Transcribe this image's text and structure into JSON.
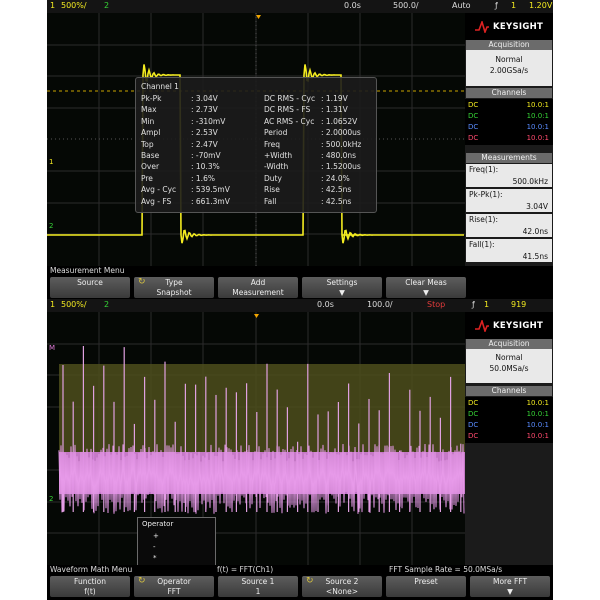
{
  "top": {
    "header": {
      "ch_num": "1",
      "ch_scale": "500%/",
      "ch2": "2",
      "time_pos": "0.0s",
      "time_scale": "500.0/",
      "trig_mode": "Auto",
      "trig_sym": "ƒ",
      "trig_ch": "1",
      "trig_level": "1.20V"
    },
    "brand": "KEYSIGHT",
    "acquisition": {
      "title": "Acquisition",
      "mode": "Normal",
      "rate": "2.00GSa/s"
    },
    "channels": {
      "title": "Channels",
      "rows": [
        {
          "coupling": "DC",
          "value": "10.0:1",
          "color": "#f2ea20"
        },
        {
          "coupling": "DC",
          "value": "10.0:1",
          "color": "#36d236"
        },
        {
          "coupling": "DC",
          "value": "10.0:1",
          "color": "#5a8cff"
        },
        {
          "coupling": "DC",
          "value": "10.0:1",
          "color": "#ff4a6e"
        }
      ]
    },
    "measurements": {
      "title": "Measurements",
      "items": [
        {
          "label": "Freq(1):",
          "value": "500.0kHz"
        },
        {
          "label": "Pk-Pk(1):",
          "value": "3.04V"
        },
        {
          "label": "Rise(1):",
          "value": "42.0ns"
        },
        {
          "label": "Fall(1):",
          "value": "41.5ns"
        }
      ]
    },
    "overlay": {
      "title": "Channel 1",
      "left": [
        [
          "Pk-Pk",
          ": 3.04V"
        ],
        [
          "Max",
          ": 2.73V"
        ],
        [
          "Min",
          ": -310mV"
        ],
        [
          "Ampl",
          ": 2.53V"
        ],
        [
          "Top",
          ": 2.47V"
        ],
        [
          "Base",
          ": -70mV"
        ],
        [
          "Over",
          ": 10.3%"
        ],
        [
          "Pre",
          ": 1.6%"
        ],
        [
          "Avg - Cyc",
          ": 539.5mV"
        ],
        [
          "Avg - FS",
          ": 661.3mV"
        ]
      ],
      "right": [
        [
          "DC RMS - Cyc",
          ": 1.19V"
        ],
        [
          "DC RMS - FS",
          ": 1.31V"
        ],
        [
          "AC RMS - Cyc",
          ": 1.0652V"
        ],
        [
          "Period",
          ": 2.0000us"
        ],
        [
          "Freq",
          ": 500.0kHz"
        ],
        [
          "+Width",
          ": 480.0ns"
        ],
        [
          "-Width",
          ": 1.5200us"
        ],
        [
          "Duty",
          ": 24.0%"
        ],
        [
          "Rise",
          ": 42.5ns"
        ],
        [
          "Fall",
          ": 42.5ns"
        ]
      ]
    },
    "menu_title": "Measurement Menu",
    "softkeys": [
      {
        "l1": "Source",
        "l2": ""
      },
      {
        "l1": "Type",
        "l2": "Snapshot",
        "icon": "↻"
      },
      {
        "l1": "Add",
        "l2": "Measurement"
      },
      {
        "l1": "Settings",
        "l2": "▼"
      },
      {
        "l1": "Clear Meas",
        "l2": "▼"
      }
    ]
  },
  "bottom": {
    "header": {
      "ch_num": "1",
      "ch_scale": "500%/",
      "ch2": "2",
      "time_pos": "0.0s",
      "time_scale": "100.0/",
      "trig_mode": "Stop",
      "trig_sym": "ƒ",
      "trig_ch": "1",
      "trig_level": "919"
    },
    "brand": "KEYSIGHT",
    "acquisition": {
      "title": "Acquisition",
      "mode": "Normal",
      "rate": "50.0MSa/s"
    },
    "channels": {
      "title": "Channels",
      "rows": [
        {
          "coupling": "DC",
          "value": "10.0:1",
          "color": "#f2ea20"
        },
        {
          "coupling": "DC",
          "value": "10.0:1",
          "color": "#36d236"
        },
        {
          "coupling": "DC",
          "value": "10.0:1",
          "color": "#5a8cff"
        },
        {
          "coupling": "DC",
          "value": "10.0:1",
          "color": "#ff4a6e"
        }
      ]
    },
    "operator_dropdown": {
      "title": "Operator",
      "items": [
        "+",
        "-",
        "*",
        "FFT"
      ],
      "selected": "FFT"
    },
    "menu_title": "Waveform Math Menu",
    "formula": "f(t) = FFT(Ch1)",
    "sample_rate": "FFT Sample Rate = 50.0MSa/s",
    "softkeys": [
      {
        "l1": "Function",
        "l2": "f(t)"
      },
      {
        "l1": "Operator",
        "l2": "FFT",
        "icon": "↻"
      },
      {
        "l1": "Source 1",
        "l2": "1"
      },
      {
        "l1": "Source 2",
        "l2": "<None>",
        "icon": "↻"
      },
      {
        "l1": "Preset",
        "l2": ""
      },
      {
        "l1": "More FFT",
        "l2": "▼"
      }
    ]
  }
}
